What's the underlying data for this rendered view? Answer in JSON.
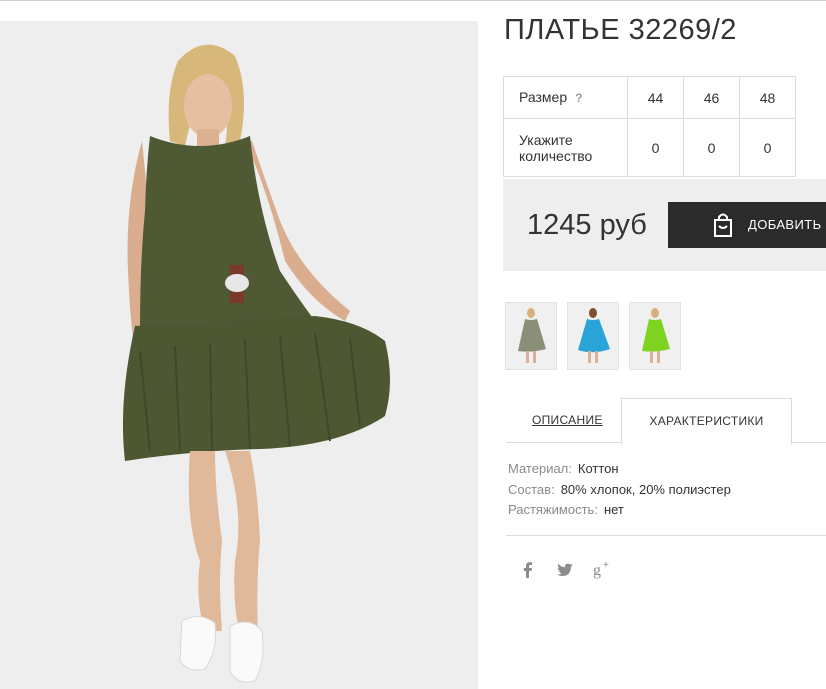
{
  "product": {
    "title": "ПЛАТЬЕ 32269/2",
    "image_alt": "Model wearing olive green sleeveless dress"
  },
  "sizes": {
    "size_label": "Размер",
    "help_glyph": "?",
    "qty_label": "Укажите количество",
    "columns": [
      "44",
      "46",
      "48"
    ],
    "quantities": [
      "0",
      "0",
      "0"
    ]
  },
  "purchase": {
    "price": "1245 руб",
    "add_label": "ДОБАВИТЬ В"
  },
  "thumbnails": [
    {
      "name": "thumb-olive",
      "dress_color": "#8a8f78"
    },
    {
      "name": "thumb-blue",
      "dress_color": "#2aa3d8"
    },
    {
      "name": "thumb-green",
      "dress_color": "#7ed321"
    }
  ],
  "tabs": {
    "description": "ОПИСАНИЕ",
    "characteristics": "ХАРАКТЕРИСТИКИ"
  },
  "specs": [
    {
      "key": "Материал:",
      "value": "Коттон"
    },
    {
      "key": "Состав:",
      "value": "80% хлопок, 20% полиэстер"
    },
    {
      "key": "Растяжимость:",
      "value": "нет"
    }
  ],
  "social": {
    "facebook": "f",
    "googleplus": "g+"
  },
  "colors": {
    "dress": "#4f5a35",
    "button": "#2b2b2b",
    "panel": "#eeeeee"
  }
}
